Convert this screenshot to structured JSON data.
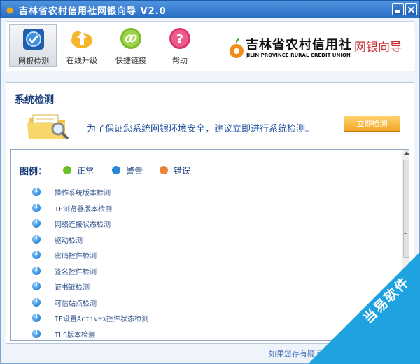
{
  "window": {
    "title": "吉林省农村信用社网银向导 V2.0",
    "minimize_label": "",
    "close_label": ""
  },
  "toolbar": {
    "items": [
      {
        "label": "网银检测",
        "icon": "monitor-check-icon",
        "active": true,
        "color": "#2a6fc6"
      },
      {
        "label": "在线升级",
        "icon": "upload-arrow-icon",
        "active": false,
        "color": "#f0a019"
      },
      {
        "label": "快捷链接",
        "icon": "link-icon",
        "active": false,
        "color": "#78b52a"
      },
      {
        "label": "帮助",
        "icon": "help-icon",
        "active": false,
        "color": "#d8386b"
      }
    ],
    "logo": {
      "name_cn": "吉林省农村信用社",
      "name_en": "JILIN PROVINCE RURAL CREDIT UNION",
      "slogan": "网银向导"
    }
  },
  "panel": {
    "title": "系统检测",
    "hint": "为了保证您系统网银环境安全，建议立即进行系统检测。",
    "start_button": "立即检测"
  },
  "legend": {
    "title": "图例：",
    "items": [
      {
        "label": "正常",
        "icon": "ok-icon",
        "color": "#6cbf2a"
      },
      {
        "label": "警告",
        "icon": "info-icon",
        "color": "#2a86d6"
      },
      {
        "label": "错误",
        "icon": "error-icon",
        "color": "#e8833a"
      }
    ]
  },
  "checks": [
    {
      "label": "操作系统版本检测",
      "status": "info"
    },
    {
      "label": "IE浏览器版本检测",
      "status": "info"
    },
    {
      "label": "网络连接状态检测",
      "status": "info"
    },
    {
      "label": "驱动检测",
      "status": "info"
    },
    {
      "label": "密码控件检测",
      "status": "info"
    },
    {
      "label": "签名控件检测",
      "status": "info"
    },
    {
      "label": "证书链检测",
      "status": "info"
    },
    {
      "label": "可信站点检测",
      "status": "info"
    },
    {
      "label": "IE设置Activex控件状态检测",
      "status": "info"
    },
    {
      "label": "TLS版本检测",
      "status": "info"
    }
  ],
  "footer": {
    "text": "如果您存有疑问"
  },
  "watermark": {
    "text": "当易软件"
  }
}
